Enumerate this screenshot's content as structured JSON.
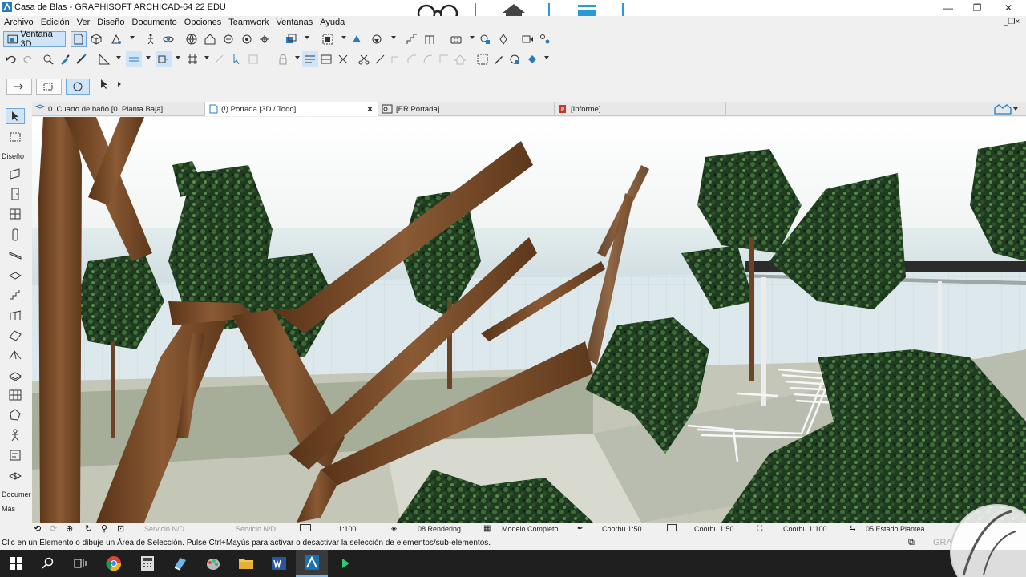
{
  "window": {
    "title": "Casa de Blas - GRAPHISOFT ARCHICAD-64 22 EDU",
    "controls": [
      "minimize-icon",
      "maximize-icon",
      "close-icon"
    ]
  },
  "menu": {
    "items": [
      "Archivo",
      "Edición",
      "Ver",
      "Diseño",
      "Documento",
      "Opciones",
      "Teamwork",
      "Ventanas",
      "Ayuda"
    ]
  },
  "toolbar": {
    "window3d_label": "Ventana 3D"
  },
  "tabs": [
    {
      "label": "0. Cuarto de baño [0. Planta Baja]"
    },
    {
      "label": "(!) Portada [3D / Todo]"
    },
    {
      "label": "[ER Portada]"
    },
    {
      "label": "[Informe]"
    }
  ],
  "tab_close_glyph": "×",
  "leftbar": {
    "design_label": "Diseño",
    "document_label": "Documer",
    "more_label": "Más"
  },
  "statusbar": {
    "service1": "Servicio N/D",
    "service2": "Servicio N/D",
    "scale": "1:100",
    "rendering": "08 Rendering",
    "model": "Modelo Completo",
    "pen1": "Coorbu 1:50",
    "pen2": "Coorbu 1:50",
    "pen3": "Coorbu 1:100",
    "state": "05 Estado Plantea..."
  },
  "hint": "Clic en un Elemento o dibuje un Área de Selección. Pulse Ctrl+Mayús para activar o desactivar la selección de elementos/sub-elementos.",
  "watermark": "GRA",
  "colors": {
    "accent": "#2a9ad6",
    "wood": "#7a4a2a",
    "foliage": "#1e3a1e",
    "sky": "#ffffff",
    "taskbar": "#1f1f1f"
  },
  "taskbar": {
    "apps": [
      "windows-start-icon",
      "search-icon",
      "task-view-icon",
      "chrome-icon",
      "calculator-icon",
      "notepad-icon",
      "paint-icon",
      "file-explorer-icon",
      "word-icon",
      "archicad-icon",
      "media-icon"
    ]
  }
}
